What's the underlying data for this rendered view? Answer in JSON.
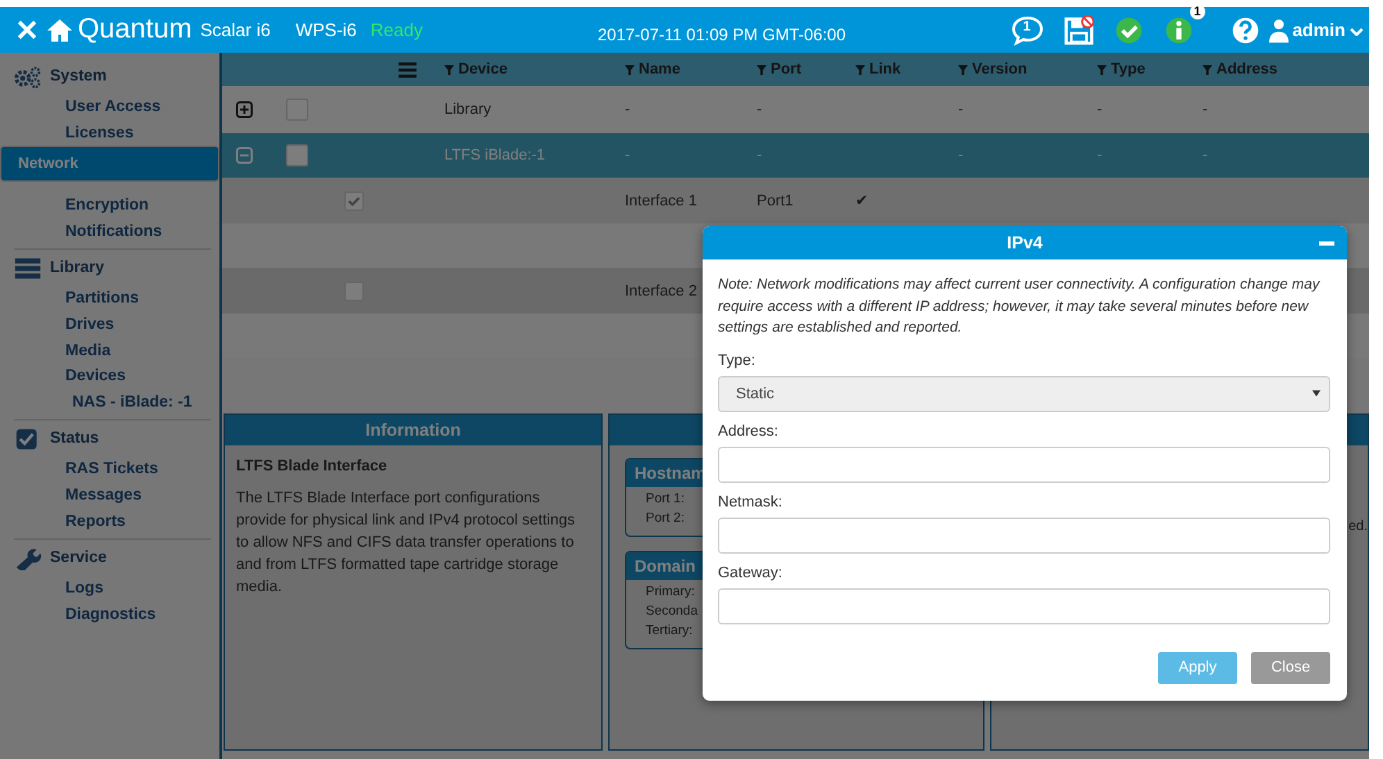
{
  "header": {
    "brand": "Quantum",
    "product": "Scalar i6",
    "host": "WPS-i6",
    "status": "Ready",
    "datetime": "2017-07-11 01:09 PM GMT-06:00",
    "messages_badge": "1",
    "info_badge": "1",
    "user": "admin"
  },
  "sidebar": [
    {
      "label": "System",
      "kind": "system",
      "items": [
        {
          "label": "User Access",
          "selected": false
        },
        {
          "label": "Licenses",
          "selected": false
        },
        {
          "label": "Network",
          "selected": true
        },
        {
          "label": "Encryption",
          "selected": false
        },
        {
          "label": "Notifications",
          "selected": false
        }
      ]
    },
    {
      "label": "Library",
      "kind": "library",
      "items": [
        {
          "label": "Partitions",
          "selected": false
        },
        {
          "label": "Drives",
          "selected": false
        },
        {
          "label": "Media",
          "selected": false
        },
        {
          "label": "Devices",
          "selected": false,
          "children": [
            {
              "label": "NAS - iBlade: -1",
              "selected": false
            }
          ]
        }
      ]
    },
    {
      "label": "Status",
      "kind": "status",
      "items": [
        {
          "label": "RAS Tickets",
          "selected": false
        },
        {
          "label": "Messages",
          "selected": false
        },
        {
          "label": "Reports",
          "selected": false
        }
      ]
    },
    {
      "label": "Service",
      "kind": "service",
      "items": [
        {
          "label": "Logs",
          "selected": false
        },
        {
          "label": "Diagnostics",
          "selected": false
        }
      ]
    }
  ],
  "table": {
    "columns": [
      "Device",
      "Name",
      "Port",
      "Link",
      "Version",
      "Type",
      "Address"
    ],
    "rows": [
      {
        "expanded": false,
        "selected": false,
        "checked": false,
        "cells": [
          "Library",
          "-",
          "-",
          "",
          "-",
          "-",
          "-"
        ],
        "children": []
      },
      {
        "expanded": true,
        "selected": true,
        "checked": false,
        "cells": [
          "LTFS iBlade:-1",
          "-",
          "-",
          "",
          "-",
          "-",
          "-"
        ],
        "children": [
          {
            "checked": true,
            "selected": false,
            "cells": [
              "",
              "Interface 1",
              "Port1",
              "✔",
              "",
              "",
              ""
            ]
          },
          {
            "checked": false,
            "selected": false,
            "cells": [
              "",
              "Interface 2",
              "",
              "",
              "",
              "",
              ""
            ]
          }
        ]
      }
    ]
  },
  "panels": [
    {
      "title": "Information",
      "heading": "LTFS Blade Interface",
      "text": "The LTFS Blade Interface port configurations provide for physical link and IPv4 protocol settings to allow NFS and CIFS data transfer operations to and from LTFS formatted tape cartridge storage media."
    },
    {
      "boxes": [
        {
          "title": "Hostnam",
          "fields": [
            "Port 1:",
            "Port 2:"
          ]
        },
        {
          "title": "Domain",
          "fields": [
            "Primary:",
            "Seconda",
            "Tertiary:"
          ]
        }
      ]
    },
    {
      "text": "ed."
    }
  ],
  "dialog": {
    "title": "IPv4",
    "note": "Note: Network modifications may affect current user connectivity. A configuration change may require access with a different IP address; however, it may take several minutes before new settings are established and reported.",
    "type_label": "Type:",
    "type_value": "Static",
    "type_disabled": true,
    "fields": [
      {
        "label": "Address:"
      },
      {
        "label": "Netmask:"
      },
      {
        "label": "Gateway:"
      }
    ],
    "buttons": [
      {
        "label": "Apply",
        "kind": "primary"
      },
      {
        "label": "Close",
        "kind": "secondary"
      }
    ]
  }
}
